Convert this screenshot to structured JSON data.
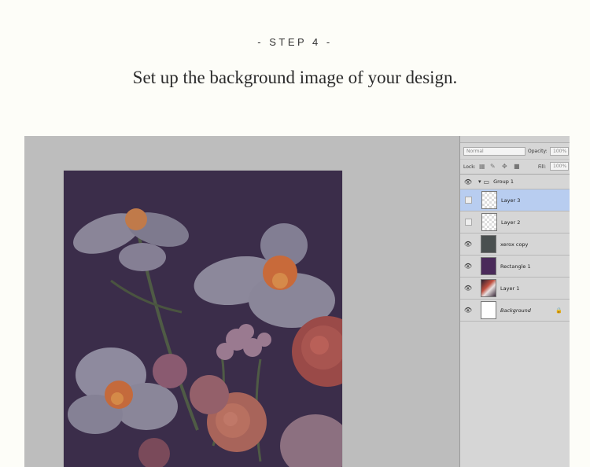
{
  "header": {
    "step": "- STEP 4 -",
    "title": "Set up the background image of your design."
  },
  "layers_panel": {
    "blend_mode": "Normal",
    "opacity_label": "Opacity:",
    "opacity_value": "100%",
    "lock_label": "Lock:",
    "fill_label": "Fill:",
    "fill_value": "100%",
    "layers": [
      {
        "name": "Group 1",
        "visible": true,
        "type": "group"
      },
      {
        "name": "Layer 3",
        "visible": false,
        "type": "layer",
        "selected": true
      },
      {
        "name": "Layer 2",
        "visible": false,
        "type": "layer"
      },
      {
        "name": "xerox copy",
        "visible": true,
        "type": "smart"
      },
      {
        "name": "Rectangle 1",
        "visible": true,
        "type": "shape"
      },
      {
        "name": "Layer 1",
        "visible": true,
        "type": "layer"
      },
      {
        "name": "Background",
        "visible": true,
        "type": "background",
        "locked": true
      }
    ]
  },
  "colors": {
    "page_bg": "#fdfdf8",
    "selected_row": "#b8cdf0",
    "canvas_overlay": "#3b2d4a"
  }
}
